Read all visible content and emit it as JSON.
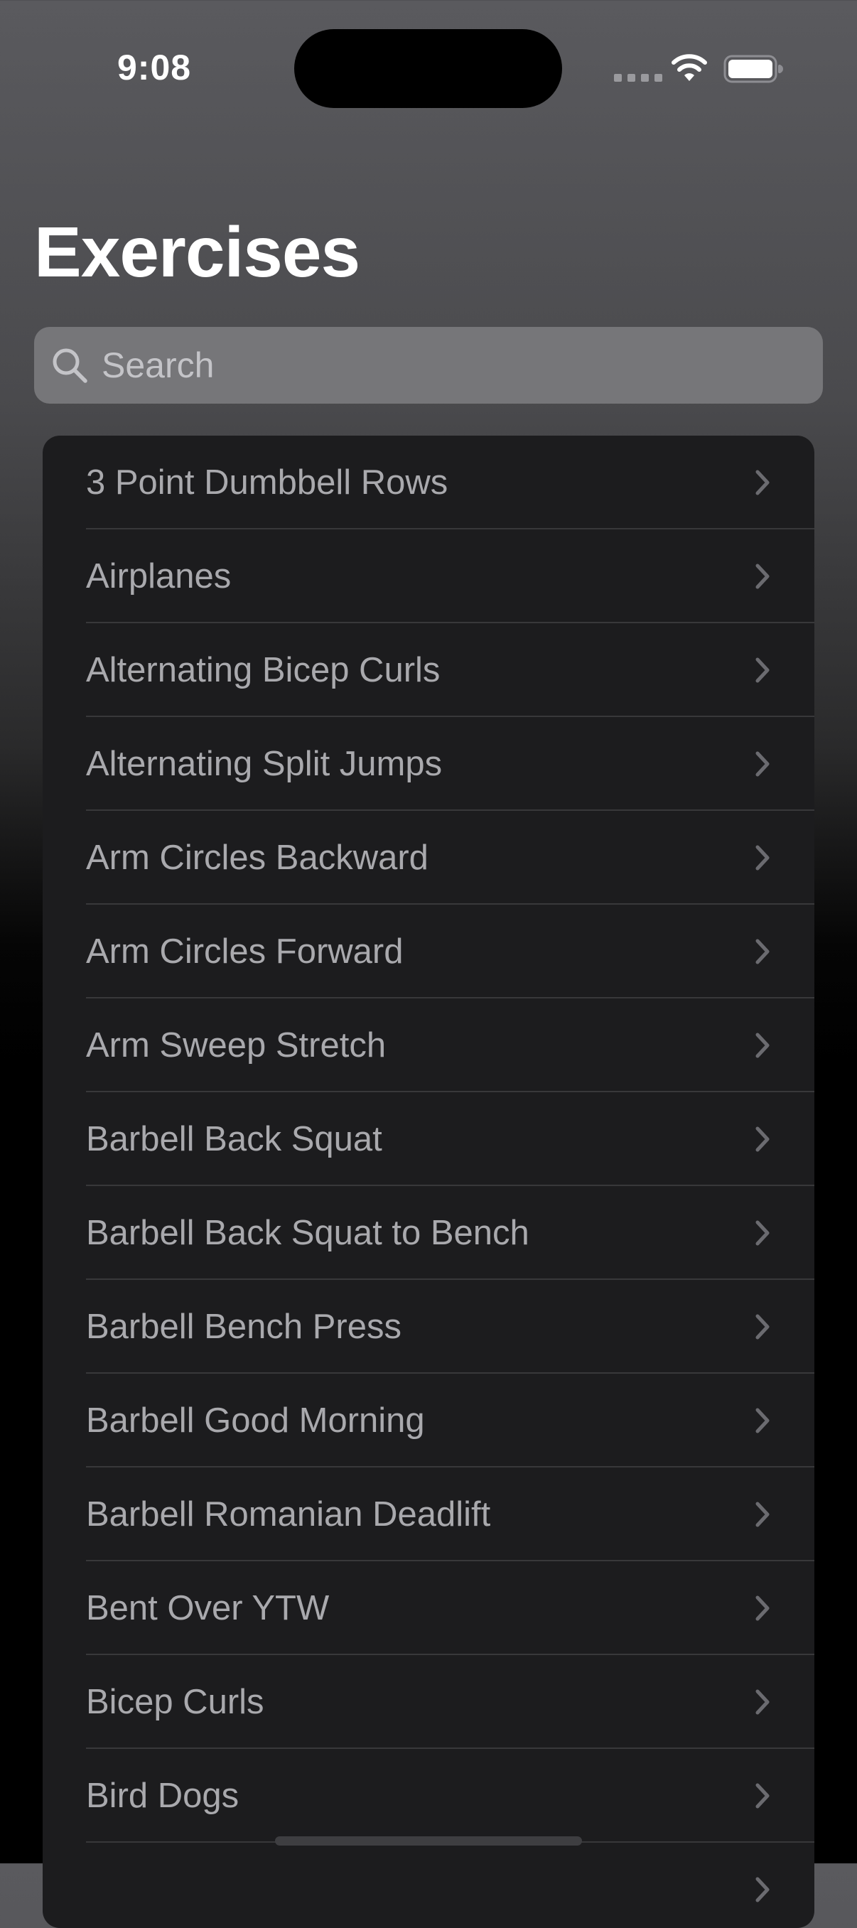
{
  "status_bar": {
    "time": "9:08"
  },
  "header": {
    "title": "Exercises"
  },
  "search": {
    "placeholder": "Search",
    "value": ""
  },
  "exercises": [
    {
      "label": "3 Point Dumbbell Rows"
    },
    {
      "label": "Airplanes"
    },
    {
      "label": "Alternating Bicep Curls"
    },
    {
      "label": "Alternating Split Jumps"
    },
    {
      "label": "Arm Circles Backward"
    },
    {
      "label": "Arm Circles Forward"
    },
    {
      "label": "Arm Sweep Stretch"
    },
    {
      "label": "Barbell Back Squat"
    },
    {
      "label": "Barbell Back Squat to Bench"
    },
    {
      "label": "Barbell Bench Press"
    },
    {
      "label": "Barbell Good Morning"
    },
    {
      "label": "Barbell Romanian Deadlift"
    },
    {
      "label": "Bent Over YTW"
    },
    {
      "label": "Bicep Curls"
    },
    {
      "label": "Bird Dogs"
    },
    {
      "label": ""
    }
  ],
  "icons": {
    "search": "search-icon",
    "chevron": "chevron-right-icon",
    "wifi": "wifi-icon",
    "battery": "battery-icon"
  },
  "colors": {
    "list_background": "#1c1c1e",
    "item_text": "#a9a9ad",
    "chevron": "#6b6b70",
    "search_field": "#767679"
  }
}
